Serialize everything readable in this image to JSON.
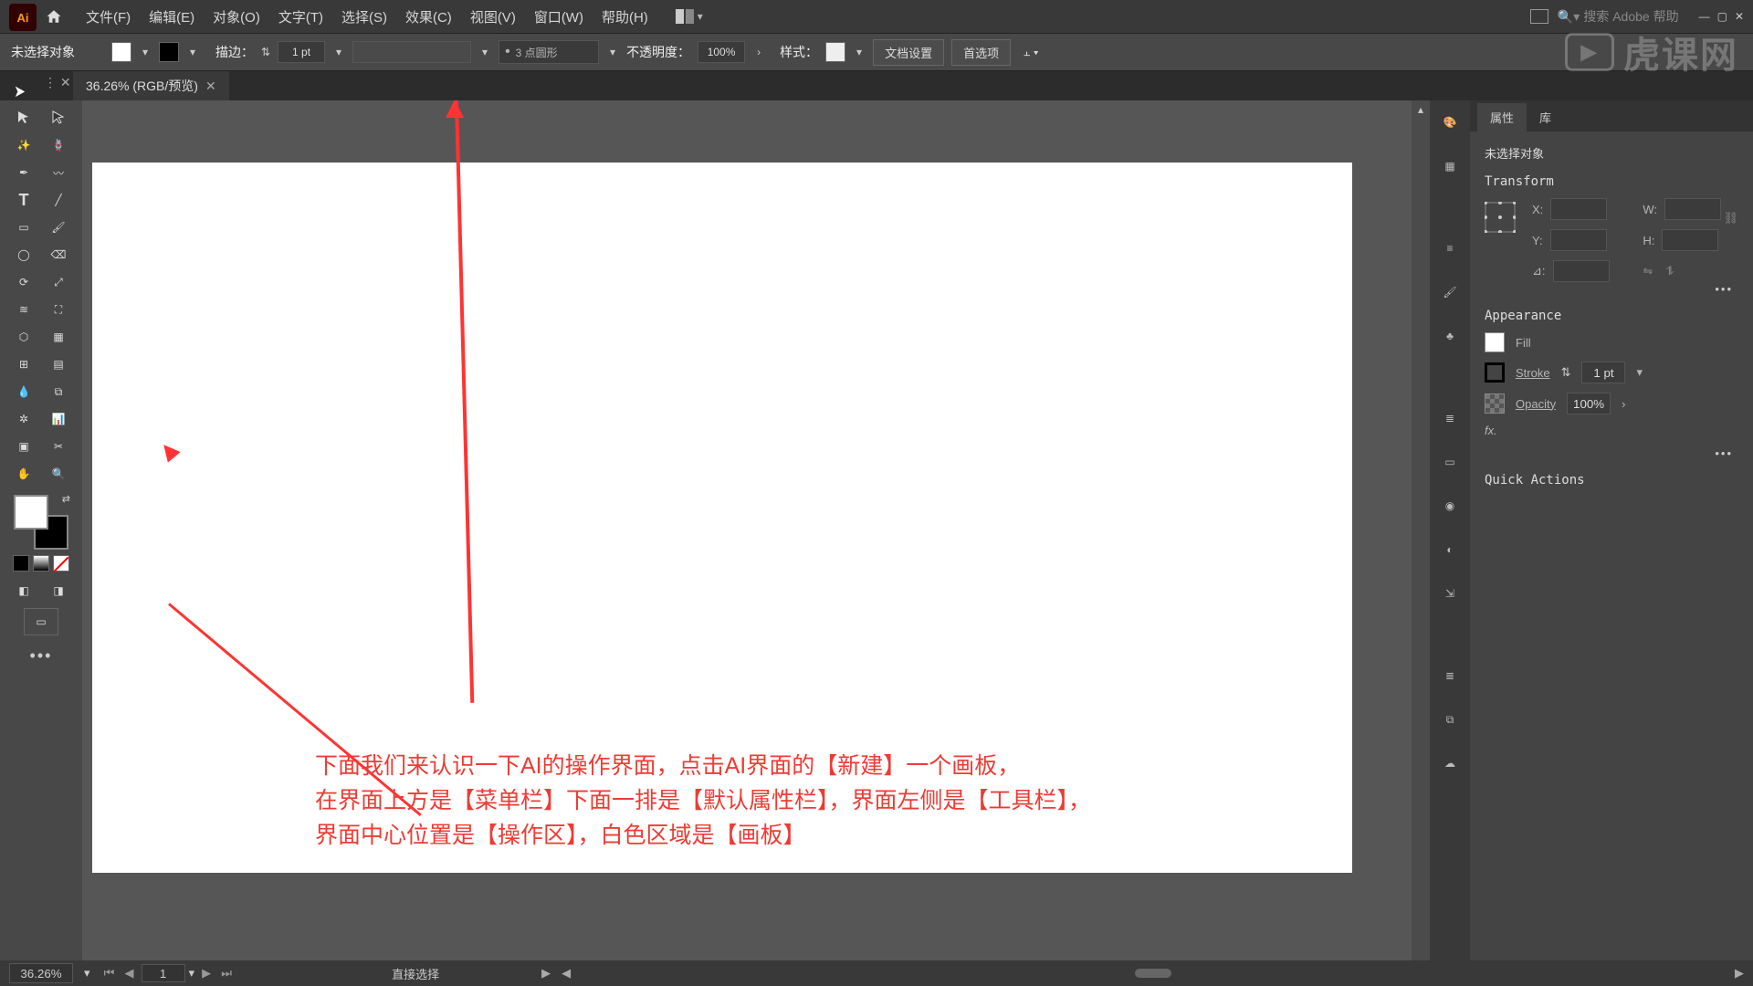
{
  "menubar": {
    "items": [
      "文件(F)",
      "编辑(E)",
      "对象(O)",
      "文字(T)",
      "选择(S)",
      "效果(C)",
      "视图(V)",
      "窗口(W)",
      "帮助(H)"
    ],
    "search_placeholder": "搜索 Adobe 帮助"
  },
  "controlbar": {
    "no_selection": "未选择对象",
    "stroke_label": "描边：",
    "stroke_width": "1 pt",
    "brush_preset": "3 点圆形",
    "opacity_label": "不透明度：",
    "opacity_value": "100%",
    "style_label": "样式：",
    "doc_setup": "文档设置",
    "prefs": "首选项"
  },
  "document": {
    "tab_title": "36.26% (RGB/预览)"
  },
  "annotation": {
    "line1": "下面我们来认识一下AI的操作界面，点击AI界面的【新建】一个画板，",
    "line2": "在界面上方是【菜单栏】下面一排是【默认属性栏】，界面左侧是【工具栏】，",
    "line3": "界面中心位置是【操作区】，白色区域是【画板】"
  },
  "panel": {
    "tabs": [
      "属性",
      "库"
    ],
    "no_selection": "未选择对象",
    "transform_title": "Transform",
    "x_label": "X:",
    "y_label": "Y:",
    "w_label": "W:",
    "h_label": "H:",
    "angle_label": "⊿:",
    "appearance_title": "Appearance",
    "fill_label": "Fill",
    "stroke_label": "Stroke",
    "stroke_value": "1 pt",
    "opacity_label": "Opacity",
    "opacity_value": "100%",
    "fx_label": "fx.",
    "quick_actions": "Quick Actions"
  },
  "statusbar": {
    "zoom": "36.26%",
    "page": "1",
    "tool": "直接选择"
  },
  "watermark": "虎课网"
}
